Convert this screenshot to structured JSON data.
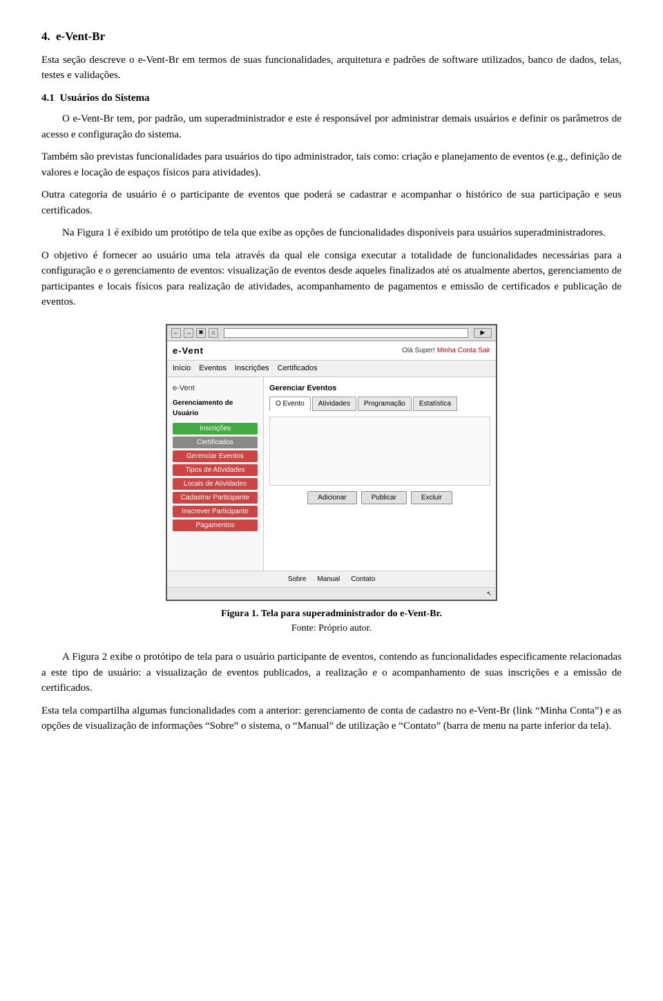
{
  "section": {
    "number": "4.",
    "title": "e-Vent-Br"
  },
  "intro_paragraph": "Esta seção descreve o e-Vent-Br em termos de suas funcionalidades, arquitetura e padrões de software utilizados, banco de dados, telas, testes e validações.",
  "subsection": {
    "number": "4.1",
    "title": "Usuários do Sistema"
  },
  "paragraphs": {
    "p1": "O e-Vent-Br tem, por padrão, um superadministrador e este é responsável por administrar demais usuários e definir os parâmetros de acesso e configuração do sistema.",
    "p2": "Também são previstas funcionalidades para usuários do tipo administrador, tais como: criação e planejamento de eventos (e.g., definição de valores e locação de espaços físicos para atividades).",
    "p3": "Outra categoria de usuário é o participante de eventos que poderá se cadastrar e acompanhar o histórico de sua participação e seus certificados.",
    "p4": "Na Figura 1 é exibido um protótipo de tela que exibe as opções de funcionalidades disponíveis para usuários superadministradores.",
    "p5": "O objetivo é fornecer ao usuário uma tela através da qual ele consiga executar a totalidade de funcionalidades necessárias para a configuração e o gerenciamento de eventos: visualização de eventos desde aqueles finalizados até os atualmente abertos, gerenciamento de participantes e locais físicos para realização de atividades, acompanhamento de pagamentos e emissão de certificados e publicação de eventos.",
    "p6": "A Figura 2 exibe o protótipo de tela para o usuário participante de eventos, contendo as funcionalidades especificamente relacionadas a este tipo de usuário: a visualização de eventos publicados, a realização e o acompanhamento de suas inscrições e a emissão de certificados.",
    "p7": "Esta tela compartilha algumas funcionalidades com a anterior: gerenciamento de conta de cadastro no e-Vent-Br (link “Minha Conta”) e as opções de visualização de informações “Sobre” o sistema, o “Manual” de utilização e “Contato” (barra de menu na parte inferior da tela)."
  },
  "figure": {
    "caption_bold": "Figura 1. Tela para superadministrador do e-Vent-Br.",
    "caption_normal": "Fonte: Próprio autor.",
    "mockup": {
      "brand": "e-Vent",
      "greeting": "Olá Super! ",
      "minha_conta": "Minha Conta",
      "sair": "Sair",
      "nav_items": [
        "Início",
        "Eventos",
        "Inscrições",
        "Certificados"
      ],
      "sidebar_brand": "e-Vent",
      "sidebar_section": "Gerenciamento de Usuário",
      "sidebar_buttons_green": [
        "Inscrições",
        "Certificados"
      ],
      "sidebar_buttons_red": [
        "Gerenciar Eventos",
        "Tipos de Atividades",
        "Locais de Atividades",
        "Cadastrar Participante",
        "Inscrever Participante",
        "Pagamentos"
      ],
      "main_section": "Gerenciar Eventos",
      "tabs": [
        "O Evento",
        "Atividades",
        "Programação",
        "Estatística"
      ],
      "action_buttons": [
        "Adicionar",
        "Publicar",
        "Excluir"
      ],
      "footer_items": [
        "Sobre",
        "Manual",
        "Contato"
      ]
    }
  }
}
